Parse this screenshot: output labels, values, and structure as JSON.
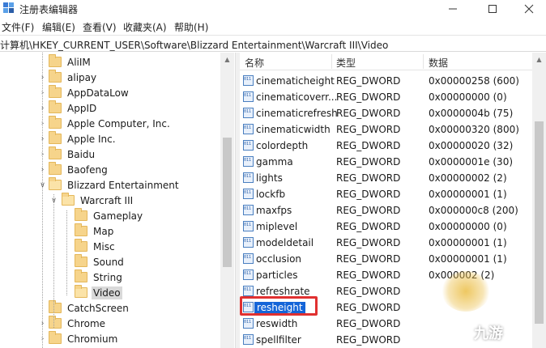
{
  "window": {
    "title": "注册表编辑器",
    "minimize_icon": "minimize-icon",
    "maximize_icon": "maximize-icon",
    "close_icon": "close-icon"
  },
  "menu": [
    "文件(F)",
    "编辑(E)",
    "查看(V)",
    "收藏夹(A)",
    "帮助(H)"
  ],
  "address": "计算机\\HKEY_CURRENT_USER\\Software\\Blizzard Entertainment\\Warcraft III\\Video",
  "tree": {
    "items": [
      {
        "label": "AliIM",
        "level": 1,
        "expander": "",
        "selected": false
      },
      {
        "label": "alipay",
        "level": 1,
        "expander": ">",
        "selected": false
      },
      {
        "label": "AppDataLow",
        "level": 1,
        "expander": ">",
        "selected": false
      },
      {
        "label": "AppID",
        "level": 1,
        "expander": ">",
        "selected": false
      },
      {
        "label": "Apple Computer, Inc.",
        "level": 1,
        "expander": ">",
        "selected": false
      },
      {
        "label": "Apple Inc.",
        "level": 1,
        "expander": ">",
        "selected": false
      },
      {
        "label": "Baidu",
        "level": 1,
        "expander": ">",
        "selected": false
      },
      {
        "label": "Baofeng",
        "level": 1,
        "expander": ">",
        "selected": false
      },
      {
        "label": "Blizzard Entertainment",
        "level": 1,
        "expander": "v",
        "selected": false
      },
      {
        "label": "Warcraft III",
        "level": 2,
        "expander": "v",
        "selected": false
      },
      {
        "label": "Gameplay",
        "level": 3,
        "expander": "",
        "selected": false
      },
      {
        "label": "Map",
        "level": 3,
        "expander": "",
        "selected": false
      },
      {
        "label": "Misc",
        "level": 3,
        "expander": "",
        "selected": false
      },
      {
        "label": "Sound",
        "level": 3,
        "expander": "",
        "selected": false
      },
      {
        "label": "String",
        "level": 3,
        "expander": "",
        "selected": false
      },
      {
        "label": "Video",
        "level": 3,
        "expander": "",
        "selected": true
      },
      {
        "label": "CatchScreen",
        "level": 1,
        "expander": "",
        "selected": false
      },
      {
        "label": "Chrome",
        "level": 1,
        "expander": ">",
        "selected": false
      },
      {
        "label": "Chromium",
        "level": 1,
        "expander": ">",
        "selected": false
      }
    ]
  },
  "list": {
    "columns": [
      "名称",
      "类型",
      "数据"
    ],
    "rows": [
      {
        "name": "cinematicheight",
        "type": "REG_DWORD",
        "data": "0x00000258 (600)"
      },
      {
        "name": "cinematicoverr...",
        "type": "REG_DWORD",
        "data": "0x00000000 (0)"
      },
      {
        "name": "cinematicrefresh",
        "type": "REG_DWORD",
        "data": "0x0000004b (75)"
      },
      {
        "name": "cinematicwidth",
        "type": "REG_DWORD",
        "data": "0x00000320 (800)"
      },
      {
        "name": "colordepth",
        "type": "REG_DWORD",
        "data": "0x00000020 (32)"
      },
      {
        "name": "gamma",
        "type": "REG_DWORD",
        "data": "0x0000001e (30)"
      },
      {
        "name": "lights",
        "type": "REG_DWORD",
        "data": "0x00000002 (2)"
      },
      {
        "name": "lockfb",
        "type": "REG_DWORD",
        "data": "0x00000001 (1)"
      },
      {
        "name": "maxfps",
        "type": "REG_DWORD",
        "data": "0x000000c8 (200)"
      },
      {
        "name": "miplevel",
        "type": "REG_DWORD",
        "data": "0x00000000 (0)"
      },
      {
        "name": "modeldetail",
        "type": "REG_DWORD",
        "data": "0x00000001 (1)"
      },
      {
        "name": "occlusion",
        "type": "REG_DWORD",
        "data": "0x00000001 (1)"
      },
      {
        "name": "particles",
        "type": "REG_DWORD",
        "data": "0x000002 (2)"
      },
      {
        "name": "refreshrate",
        "type": "REG_DWORD",
        "data": ""
      },
      {
        "name": "resheight",
        "type": "REG_DWORD",
        "data": "",
        "selected": true
      },
      {
        "name": "reswidth",
        "type": "REG_DWORD",
        "data": ""
      },
      {
        "name": "spellfilter",
        "type": "REG_DWORD",
        "data": ""
      }
    ]
  },
  "watermark": "九游",
  "colors": {
    "selection": "#1565d8",
    "highlight_box": "#e03030",
    "folder": "#f6d48b"
  }
}
